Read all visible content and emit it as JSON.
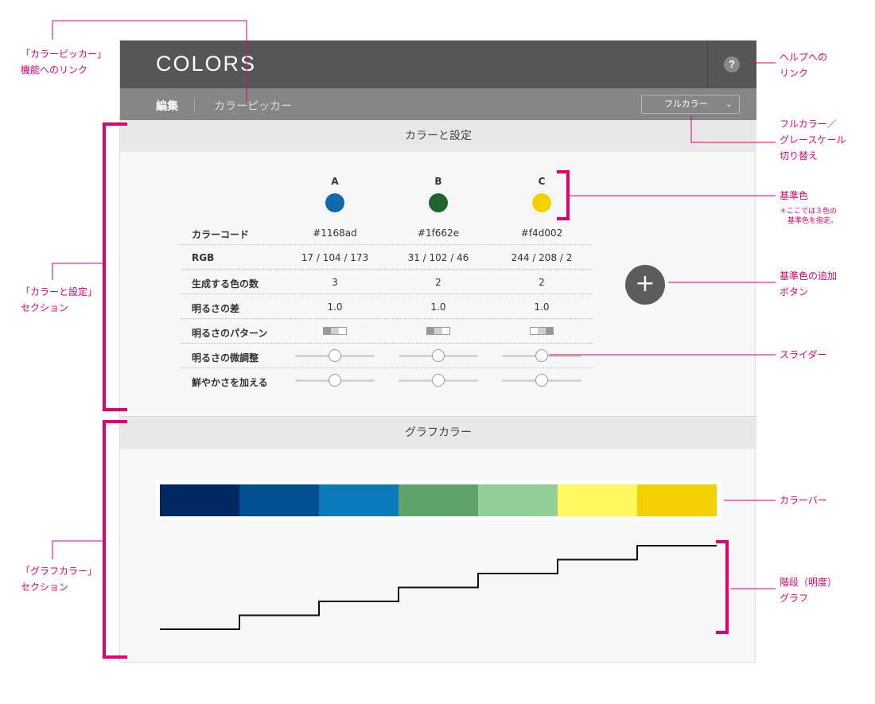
{
  "app": {
    "logo": "COLORS",
    "help_label": "?",
    "nav": {
      "edit": "編集",
      "picker": "カラーピッカー"
    },
    "mode_select": {
      "value": "フルカラー",
      "chevron": "⌄"
    }
  },
  "settings": {
    "title": "カラーと設定",
    "add_button": "+",
    "columns": [
      {
        "label": "A",
        "color": "#1168ad"
      },
      {
        "label": "B",
        "color": "#1f662e"
      },
      {
        "label": "C",
        "color": "#f4d002"
      }
    ],
    "rows": {
      "code": {
        "label": "カラーコード",
        "values": [
          "#1168ad",
          "#1f662e",
          "#f4d002"
        ]
      },
      "rgb": {
        "label": "RGB",
        "values": [
          "17 / 104 / 173",
          "31 / 102 / 46",
          "244 / 208 / 2"
        ]
      },
      "count": {
        "label": "生成する色の数",
        "values": [
          "3",
          "2",
          "2"
        ]
      },
      "diff": {
        "label": "明るさの差",
        "values": [
          "1.0",
          "1.0",
          "1.0"
        ]
      },
      "pattern": {
        "label": "明るさのパターン"
      },
      "fine": {
        "label": "明るさの微調整",
        "values": [
          0.5,
          0.5,
          0.5
        ]
      },
      "vivid": {
        "label": "鮮やかさを加える",
        "values": [
          0.5,
          0.5,
          0.5
        ]
      }
    }
  },
  "graph": {
    "title": "グラフカラー",
    "colorbar": [
      "#002863",
      "#004f93",
      "#0b7abd",
      "#60a36a",
      "#92cf98",
      "#fff95f",
      "#f4d002"
    ],
    "steps": [
      1,
      2,
      3,
      4,
      5,
      6,
      7
    ]
  },
  "annotations": {
    "picker_link": [
      "「カラーピッカー」",
      "機能へのリンク"
    ],
    "settings_section": [
      "「カラーと設定」",
      "セクション"
    ],
    "graph_section": [
      "「グラフカラー」",
      "セクション"
    ],
    "help_link": [
      "ヘルプへの",
      "リンク"
    ],
    "mode_switch": [
      "フルカラー／",
      "グレースケール",
      "切り替え"
    ],
    "base_color": "基準色",
    "base_color_note": [
      "＊ここでは３色の",
      "基準色を指定。"
    ],
    "add_base": [
      "基準色の追加",
      "ボタン"
    ],
    "slider": "スライダー",
    "colorbar": "カラーバー",
    "step_graph": [
      "階段（明度）",
      "グラフ"
    ]
  }
}
